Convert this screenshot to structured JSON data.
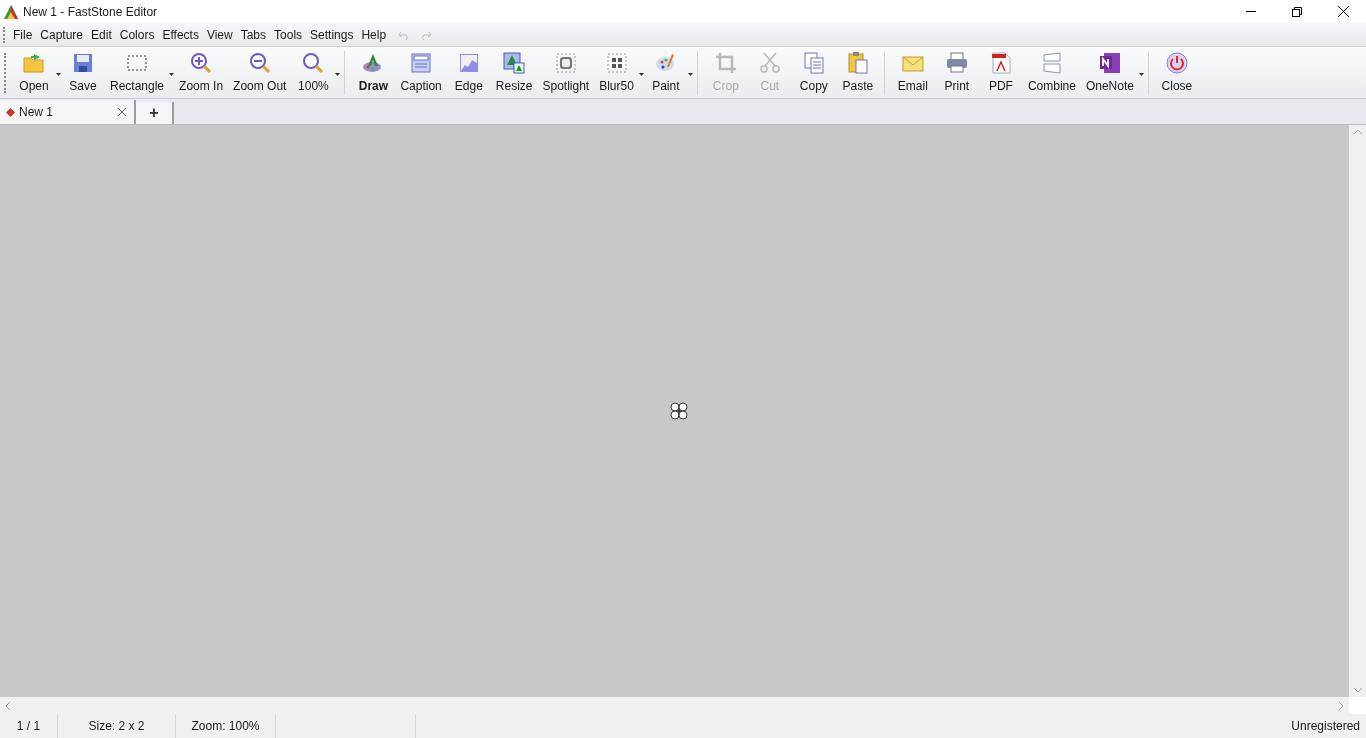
{
  "window": {
    "title": "New 1 - FastStone Editor"
  },
  "menu": [
    "File",
    "Capture",
    "Edit",
    "Colors",
    "Effects",
    "View",
    "Tabs",
    "Tools",
    "Settings",
    "Help"
  ],
  "toolbar": [
    [
      {
        "label": "Open",
        "has_menu": true,
        "disabled": false,
        "bold": false
      },
      {
        "label": "Save",
        "has_menu": false,
        "disabled": false,
        "bold": false
      },
      {
        "label": "Rectangle",
        "has_menu": true,
        "disabled": false,
        "bold": false
      },
      {
        "label": "Zoom In",
        "has_menu": false,
        "disabled": false,
        "bold": false
      },
      {
        "label": "Zoom Out",
        "has_menu": false,
        "disabled": false,
        "bold": false
      },
      {
        "label": "100%",
        "has_menu": true,
        "disabled": false,
        "bold": false
      }
    ],
    [
      {
        "label": "Draw",
        "has_menu": false,
        "disabled": false,
        "bold": true
      },
      {
        "label": "Caption",
        "has_menu": false,
        "disabled": false,
        "bold": false
      },
      {
        "label": "Edge",
        "has_menu": false,
        "disabled": false,
        "bold": false
      },
      {
        "label": "Resize",
        "has_menu": false,
        "disabled": false,
        "bold": false
      },
      {
        "label": "Spotlight",
        "has_menu": false,
        "disabled": false,
        "bold": false
      },
      {
        "label": "Blur50",
        "has_menu": true,
        "disabled": false,
        "bold": false
      },
      {
        "label": "Paint",
        "has_menu": true,
        "disabled": false,
        "bold": false
      }
    ],
    [
      {
        "label": "Crop",
        "has_menu": false,
        "disabled": true,
        "bold": false
      },
      {
        "label": "Cut",
        "has_menu": false,
        "disabled": true,
        "bold": false
      },
      {
        "label": "Copy",
        "has_menu": false,
        "disabled": false,
        "bold": false
      },
      {
        "label": "Paste",
        "has_menu": false,
        "disabled": false,
        "bold": false
      }
    ],
    [
      {
        "label": "Email",
        "has_menu": false,
        "disabled": false,
        "bold": false
      },
      {
        "label": "Print",
        "has_menu": false,
        "disabled": false,
        "bold": false
      },
      {
        "label": "PDF",
        "has_menu": false,
        "disabled": false,
        "bold": false
      },
      {
        "label": "Combine",
        "has_menu": false,
        "disabled": false,
        "bold": false
      },
      {
        "label": "OneNote",
        "has_menu": true,
        "disabled": false,
        "bold": false
      }
    ],
    [
      {
        "label": "Close",
        "has_menu": false,
        "disabled": false,
        "bold": false
      }
    ]
  ],
  "tabs": [
    {
      "label": "New 1",
      "selected": true
    }
  ],
  "new_tab": "+",
  "status_bar": [
    "1 / 1",
    "Size: 2 x 2",
    "Zoom: 100%",
    "Unregistered"
  ]
}
